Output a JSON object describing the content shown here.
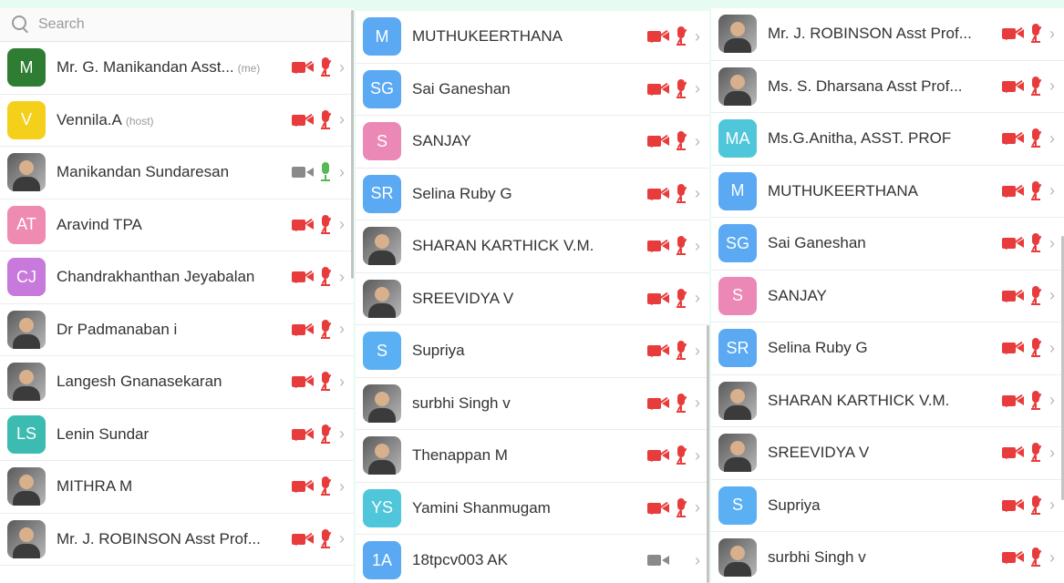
{
  "search": {
    "placeholder": "Search"
  },
  "colors": {
    "muted_icon": "#e83c3c",
    "active_cam": "#8a8a8a",
    "active_mic": "#58b858"
  },
  "columns": [
    {
      "rows": [
        {
          "initials": "M",
          "name": "Mr. G. Manikandan Asst...",
          "tag": "(me)",
          "color": "#2e7d32",
          "photo": false,
          "cam": "off",
          "mic": "off"
        },
        {
          "initials": "V",
          "name": "Vennila.A",
          "tag": "(host)",
          "color": "#f4d01b",
          "photo": false,
          "cam": "off",
          "mic": "off"
        },
        {
          "initials": "",
          "name": "Manikandan Sundaresan",
          "tag": "",
          "color": "",
          "photo": true,
          "cam": "on",
          "mic": "on"
        },
        {
          "initials": "AT",
          "name": "Aravind TPA",
          "tag": "",
          "color": "#ef8ab0",
          "photo": false,
          "cam": "off",
          "mic": "off"
        },
        {
          "initials": "CJ",
          "name": "Chandrakhanthan Jeyabalan",
          "tag": "",
          "color": "#c879dc",
          "photo": false,
          "cam": "off",
          "mic": "off"
        },
        {
          "initials": "",
          "name": "Dr Padmanaban i",
          "tag": "",
          "color": "",
          "photo": true,
          "cam": "off",
          "mic": "off"
        },
        {
          "initials": "",
          "name": "Langesh Gnanasekaran",
          "tag": "",
          "color": "",
          "photo": true,
          "cam": "off",
          "mic": "off"
        },
        {
          "initials": "LS",
          "name": "Lenin Sundar",
          "tag": "",
          "color": "#3cbcb0",
          "photo": false,
          "cam": "off",
          "mic": "off"
        },
        {
          "initials": "",
          "name": "MITHRA M",
          "tag": "",
          "color": "",
          "photo": true,
          "cam": "off",
          "mic": "off"
        },
        {
          "initials": "",
          "name": "Mr. J. ROBINSON Asst Prof...",
          "tag": "",
          "color": "",
          "photo": true,
          "cam": "off",
          "mic": "off"
        }
      ]
    },
    {
      "rows": [
        {
          "initials": "M",
          "name": "MUTHUKEERTHANA",
          "tag": "",
          "color": "#5aa9f2",
          "photo": false,
          "cam": "off",
          "mic": "off"
        },
        {
          "initials": "SG",
          "name": "Sai Ganeshan",
          "tag": "",
          "color": "#5aa9f2",
          "photo": false,
          "cam": "off",
          "mic": "off"
        },
        {
          "initials": "S",
          "name": "SANJAY",
          "tag": "",
          "color": "#ec88b5",
          "photo": false,
          "cam": "off",
          "mic": "off"
        },
        {
          "initials": "SR",
          "name": "Selina Ruby G",
          "tag": "",
          "color": "#5aa9f2",
          "photo": false,
          "cam": "off",
          "mic": "off"
        },
        {
          "initials": "",
          "name": "SHARAN KARTHICK V.M.",
          "tag": "",
          "color": "",
          "photo": true,
          "cam": "off",
          "mic": "off"
        },
        {
          "initials": "",
          "name": "SREEVIDYA V",
          "tag": "",
          "color": "",
          "photo": true,
          "cam": "off",
          "mic": "off"
        },
        {
          "initials": "S",
          "name": "Supriya",
          "tag": "",
          "color": "#5ab0f2",
          "photo": false,
          "cam": "off",
          "mic": "off"
        },
        {
          "initials": "",
          "name": "surbhi Singh v",
          "tag": "",
          "color": "",
          "photo": true,
          "cam": "off",
          "mic": "off"
        },
        {
          "initials": "",
          "name": "Thenappan M",
          "tag": "",
          "color": "",
          "photo": true,
          "cam": "off",
          "mic": "off"
        },
        {
          "initials": "YS",
          "name": "Yamini Shanmugam",
          "tag": "",
          "color": "#4fc6d9",
          "photo": false,
          "cam": "off",
          "mic": "off"
        },
        {
          "initials": "1A",
          "name": "18tpcv003 AK",
          "tag": "",
          "color": "#5aa9f2",
          "photo": false,
          "cam": "on",
          "mic": "none"
        }
      ]
    },
    {
      "rows": [
        {
          "initials": "",
          "name": "Mr. J. ROBINSON Asst Prof...",
          "tag": "",
          "color": "",
          "photo": true,
          "cam": "off",
          "mic": "off"
        },
        {
          "initials": "",
          "name": "Ms. S. Dharsana Asst Prof...",
          "tag": "",
          "color": "",
          "photo": true,
          "cam": "off",
          "mic": "off"
        },
        {
          "initials": "MA",
          "name": "Ms.G.Anitha, ASST. PROF",
          "tag": "",
          "color": "#4fc6d9",
          "photo": false,
          "cam": "off",
          "mic": "off"
        },
        {
          "initials": "M",
          "name": "MUTHUKEERTHANA",
          "tag": "",
          "color": "#5aa9f2",
          "photo": false,
          "cam": "off",
          "mic": "off"
        },
        {
          "initials": "SG",
          "name": "Sai Ganeshan",
          "tag": "",
          "color": "#5aa9f2",
          "photo": false,
          "cam": "off",
          "mic": "off"
        },
        {
          "initials": "S",
          "name": "SANJAY",
          "tag": "",
          "color": "#ec88b5",
          "photo": false,
          "cam": "off",
          "mic": "off"
        },
        {
          "initials": "SR",
          "name": "Selina Ruby G",
          "tag": "",
          "color": "#5aa9f2",
          "photo": false,
          "cam": "off",
          "mic": "off"
        },
        {
          "initials": "",
          "name": "SHARAN KARTHICK V.M.",
          "tag": "",
          "color": "",
          "photo": true,
          "cam": "off",
          "mic": "off"
        },
        {
          "initials": "",
          "name": "SREEVIDYA V",
          "tag": "",
          "color": "",
          "photo": true,
          "cam": "off",
          "mic": "off"
        },
        {
          "initials": "S",
          "name": "Supriya",
          "tag": "",
          "color": "#5ab0f2",
          "photo": false,
          "cam": "off",
          "mic": "off"
        },
        {
          "initials": "",
          "name": "surbhi Singh v",
          "tag": "",
          "color": "",
          "photo": true,
          "cam": "off",
          "mic": "off"
        }
      ]
    }
  ],
  "chevron": "›"
}
